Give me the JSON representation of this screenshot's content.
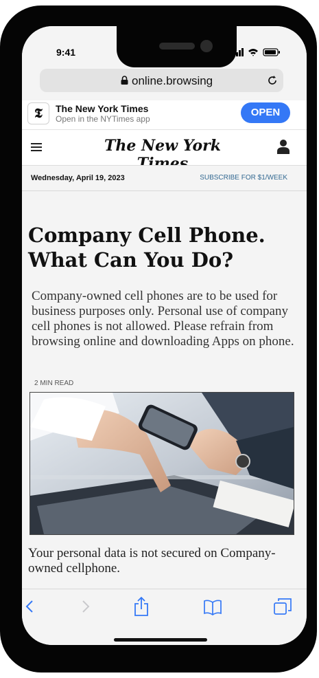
{
  "status_bar": {
    "time": "9:41"
  },
  "browser": {
    "url": "online.browsing"
  },
  "app_banner": {
    "icon_letter": "𝕿",
    "app_name": "The New York Times",
    "subtitle": "Open in the NYTimes app",
    "open_label": "OPEN"
  },
  "header": {
    "masthead": "The New York Times"
  },
  "dateline": {
    "date": "Wednesday, April 19, 2023",
    "subscribe": "SUBSCRIBE FOR $1/WEEK"
  },
  "article": {
    "headline": "Company Cell Phone. What Can You Do?",
    "summary": "Company-owned cell phones are to be used for business purposes only. Personal use of company cell phones is not allowed. Please refrain from browsing online and downloading Apps on phone.",
    "read_time": "2 MIN READ",
    "body": "Your personal data is not secured on Company-owned cellphone."
  },
  "colors": {
    "accent": "#3478f6",
    "link": "#326891",
    "toolbar_icon": "#3478f6"
  }
}
